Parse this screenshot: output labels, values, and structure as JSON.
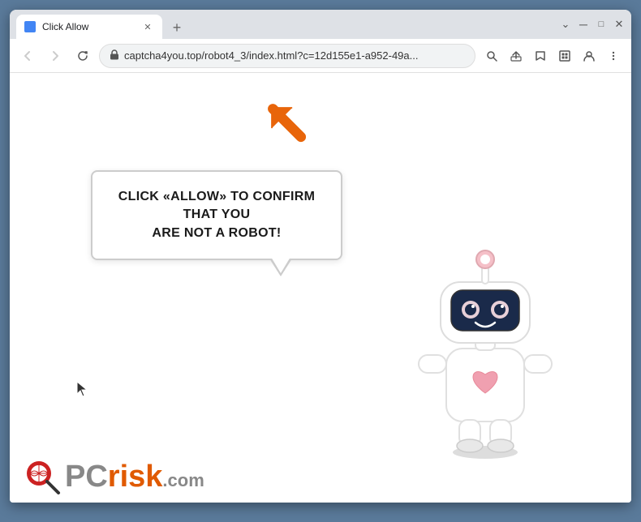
{
  "browser": {
    "tab": {
      "title": "Click Allow",
      "favicon": "🔵"
    },
    "window_controls": {
      "minimize": "─",
      "maximize": "□",
      "close": "✕"
    },
    "nav": {
      "back_disabled": true,
      "forward_disabled": true,
      "reload": true
    },
    "address_bar": {
      "url": "captcha4you.top/robot4_3/index.html?c=12d155e1-a952-49a...",
      "lock_symbol": "🔒"
    },
    "toolbar_icons": {
      "search": "🔍",
      "share": "↗",
      "star": "☆",
      "tablet": "▭",
      "person": "👤",
      "menu": "⋮"
    }
  },
  "page": {
    "bubble_text_line1": "CLICK «ALLOW» TO CONFIRM THAT YOU",
    "bubble_text_line2": "ARE NOT A ROBOT!",
    "logo": {
      "pc": "PC",
      "risk": "risk",
      "dot_com": ".com"
    }
  },
  "colors": {
    "arrow_orange": "#e8650a",
    "logo_orange": "#e05a00",
    "logo_gray": "#888888",
    "browser_bg": "#dee1e6",
    "tab_active": "#ffffff",
    "page_bg": "#ffffff"
  }
}
